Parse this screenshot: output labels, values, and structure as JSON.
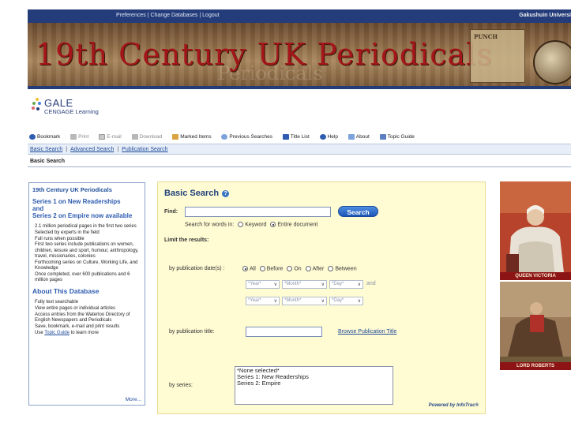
{
  "topbar": {
    "preferences": "Preferences",
    "change_databases": "Change Databases",
    "logout": "Logout",
    "separator": "|",
    "institution": "Gakushuin Universi"
  },
  "banner": {
    "title": "19th Century UK Periodicals",
    "cartoon_text": "PUNCH"
  },
  "logo": {
    "name": "GALE",
    "tagline": "CENGAGE Learning",
    "colors": [
      "#2a3f7a",
      "#6aa84f",
      "#f1c232",
      "#e06666",
      "#4a86e8"
    ]
  },
  "toolbar": {
    "items": [
      {
        "label": "Bookmark",
        "icon": "bookmark-icon",
        "color": "#2d5cb0"
      },
      {
        "label": "Print",
        "icon": "printer-icon",
        "color": "#999999"
      },
      {
        "label": "E-mail",
        "icon": "email-icon",
        "color": "#999999"
      },
      {
        "label": "Download",
        "icon": "download-icon",
        "color": "#999999"
      },
      {
        "label": "Marked Items",
        "icon": "folder-icon",
        "color": "#d9a441"
      },
      {
        "label": "Previous Searches",
        "icon": "search-history-icon",
        "color": "#2d5cb0"
      },
      {
        "label": "Title List",
        "icon": "title-list-icon",
        "color": "#2d5cb0"
      },
      {
        "label": "Help",
        "icon": "help-icon",
        "color": "#2d5cb0"
      },
      {
        "label": "About",
        "icon": "about-icon",
        "color": "#2d5cb0"
      },
      {
        "label": "Topic Guide",
        "icon": "topic-guide-icon",
        "color": "#2d5cb0"
      }
    ]
  },
  "search_nav": {
    "basic": "Basic Search",
    "advanced": "Advanced Search",
    "publication": "Publication Search",
    "separator": "|"
  },
  "breadcrumb": "Basic Search",
  "left_panel": {
    "heading": "19th Century UK Periodicals",
    "promo_line1": "Series 1 on New Readerships",
    "promo_line2": "and",
    "promo_line3": "Series 2 on Empire now available",
    "bullets": [
      "2.1 million periodical pages in the first two series",
      "Selected by experts in the field",
      "Full runs when possible",
      "First two series include publications on women, children, leisure and sport, humour, anthropology, travel, missionaries, colonies",
      "Forthcoming series on Culture, Working Life, and Knowledge",
      "Once completed, over 600 publications and 6 million pages"
    ],
    "about_heading": "About This Database",
    "about_bullets": [
      "Fully text searchable",
      "View entire pages or individual articles",
      "Access entries from the Waterloo Directory of English Newspapers and Periodicals",
      "Save, bookmark, e-mail and print results"
    ],
    "use_prefix": "Use",
    "use_link": "Topic Guide",
    "use_suffix": "to learn more",
    "more": "More..."
  },
  "form": {
    "heading": "Basic Search",
    "find_label": "Find:",
    "find_value": "",
    "search_button": "Search",
    "search_for_label": "Search for words in:",
    "keyword": "Keyword",
    "entire_document": "Entire document",
    "limit_label": "Limit the results:",
    "date_label": "by publication date(s) :",
    "date_all": "All",
    "date_before": "Before",
    "date_on": "On",
    "date_after": "After",
    "date_between": "Between",
    "year_placeholder": "*Year*",
    "month_placeholder": "*Month*",
    "day_placeholder": "*Day*",
    "and": "and",
    "pub_title_label": "by publication title:",
    "browse_link": "Browse Publication Title",
    "series_label": "by series:",
    "series_options": [
      "*None selected*",
      "Series 1: New Readerships",
      "Series 2: Empire"
    ],
    "powered": "Powered by InfoTrac®"
  },
  "portraits": [
    {
      "caption": "QUEEN VICTORIA"
    },
    {
      "caption": "LORD ROBERTS"
    }
  ],
  "colors": {
    "nav_blue": "#243d7a",
    "link_blue": "#1e4a9a",
    "form_bg": "#fffbd3",
    "banner_red": "#a4161a",
    "caption_red": "#8c1414"
  }
}
